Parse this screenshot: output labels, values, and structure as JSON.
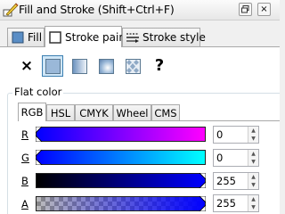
{
  "window": {
    "title": "Fill and Stroke (Shift+Ctrl+F)"
  },
  "titlebar_buttons": {
    "close": "×"
  },
  "tabs": [
    {
      "label": "Fill",
      "icon": "fill-icon"
    },
    {
      "label": "Stroke paint",
      "icon": "stroke-paint-icon",
      "active": true
    },
    {
      "label": "Stroke style",
      "icon": "stroke-style-icon"
    }
  ],
  "paint_types": [
    {
      "name": "no-paint",
      "glyph": "×"
    },
    {
      "name": "flat-color",
      "selected": true
    },
    {
      "name": "linear-gradient"
    },
    {
      "name": "radial-gradient"
    },
    {
      "name": "pattern"
    },
    {
      "name": "unset",
      "glyph": "?"
    }
  ],
  "section": {
    "label": "Flat color"
  },
  "color_tabs": [
    "RGB",
    "HSL",
    "CMYK",
    "Wheel",
    "CMS"
  ],
  "active_color_tab": "RGB",
  "channels": [
    {
      "label": "R",
      "value": "0"
    },
    {
      "label": "G",
      "value": "0"
    },
    {
      "label": "B",
      "value": "255"
    },
    {
      "label": "A",
      "value": "255"
    }
  ],
  "colors": {
    "accent": "#3c7fb1",
    "selected_bg": "#cfe6f7"
  }
}
